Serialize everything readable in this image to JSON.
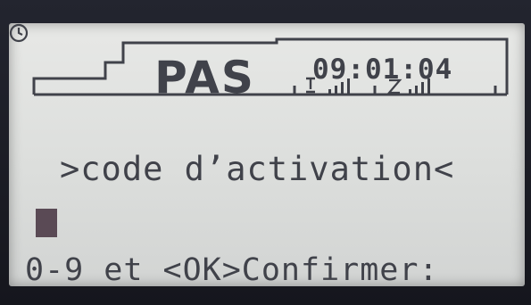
{
  "header": {
    "brand": "PAS",
    "time": "09:01:04",
    "icons": [
      "clock-icon",
      "antenna-signal-icon",
      "gsm-signal-icon"
    ]
  },
  "screen": {
    "message": ">code d’activation<",
    "footer": "0-9 et <OK>Confirmer:"
  },
  "colors": {
    "lcd_background": "#e1e3e1",
    "lcd_ink": "#40424a",
    "cursor": "#5a4a55"
  }
}
